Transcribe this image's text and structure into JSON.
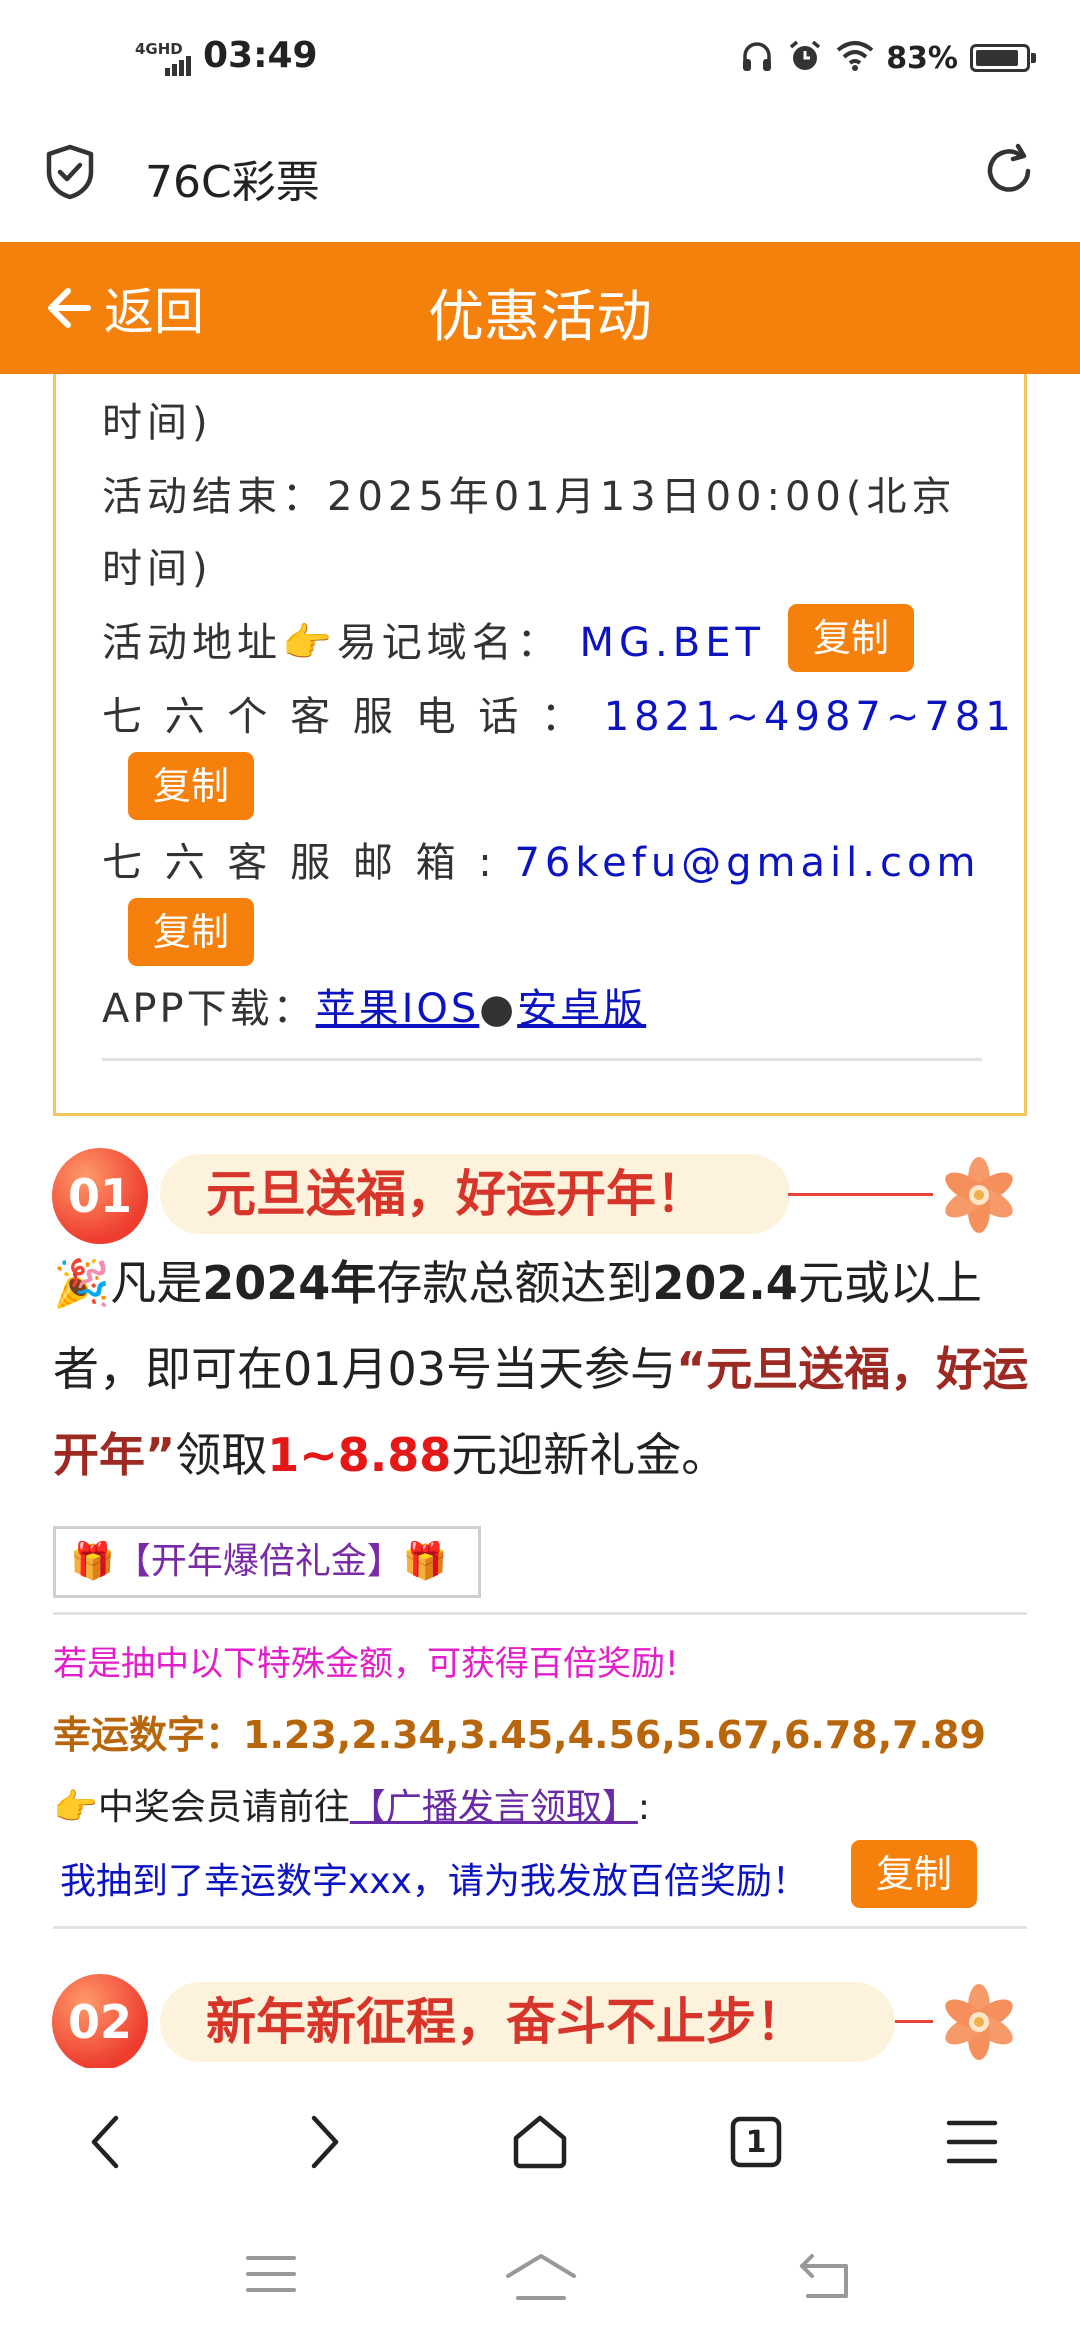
{
  "status_bar": {
    "network": "4GHD",
    "time": "03:49",
    "battery": "83%"
  },
  "browser": {
    "title": "76C彩票"
  },
  "header": {
    "back_label": "返回",
    "title": "优惠活动"
  },
  "info": {
    "line0": "时间)",
    "end_label": "活动结束：2025年01月13日00:00(北京",
    "end_tail": "时间)",
    "domain_label": "活动地址👉易记域名：",
    "domain_value": "MG.BET",
    "phone_label": "七 六 个 客 服 电 话 ：",
    "phone_value": "1821~4987~781",
    "email_label": "七 六 客 服 邮 箱 :",
    "email_value": "76kefu@gmail.com",
    "app_label": "APP下载：",
    "ios_link": "苹果IOS",
    "separator": "●",
    "android_link": "安卓版",
    "copy_label": "复制"
  },
  "section1": {
    "number": "01",
    "title": "元旦送福，好运开年！",
    "text": {
      "emoji": "🎉",
      "p1": "凡是",
      "b1": "2024年",
      "p2": "存款总额达到",
      "b2": "202.4",
      "p3": "元或以上者，即可在01月03号当天参与",
      "q": "“元旦送福，好运开年”",
      "p4": "领取",
      "amount": "1~8.88",
      "p5": "元迎新礼金。"
    },
    "gift_label": "🎁【开年爆倍礼金】🎁",
    "special_notice": "若是抽中以下特殊金额，可获得百倍奖励!",
    "lucky_numbers": "幸运数字：1.23,2.34,3.45,4.56,5.67,6.78,7.89",
    "winner_prefix": "👉中奖会员请前往",
    "winner_link": "【广播发言领取】",
    "winner_suffix": ":",
    "message": "我抽到了幸运数字xxx，请为我发放百倍奖励！",
    "copy_label": "复制"
  },
  "section2": {
    "number": "02",
    "title": "新年新征程，奋斗不止步！"
  },
  "bottom_nav": {
    "tab_count": "1"
  },
  "colors": {
    "brand_orange": "#f5810d",
    "link_blue": "#0c14c2",
    "accent_red": "#e51717"
  }
}
